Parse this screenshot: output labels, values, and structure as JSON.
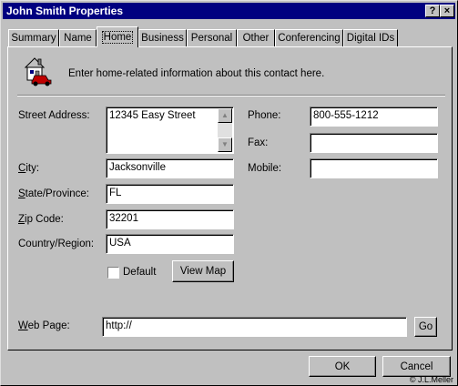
{
  "window": {
    "title": "John Smith Properties",
    "help_glyph": "?",
    "close_glyph": "×"
  },
  "tabs": [
    "Summary",
    "Name",
    "Home",
    "Business",
    "Personal",
    "Other",
    "Conferencing",
    "Digital IDs"
  ],
  "active_tab": "Home",
  "header": {
    "icon": "house-car-icon",
    "text": "Enter home-related information about this contact here."
  },
  "left_fields": {
    "street": {
      "label_u": "",
      "label_rest": "Street Address:",
      "value": "12345 Easy Street"
    },
    "city": {
      "label_u": "C",
      "label_rest": "ity:",
      "value": "Jacksonville"
    },
    "state": {
      "label_u": "S",
      "label_rest": "tate/Province:",
      "value": "FL"
    },
    "zip": {
      "label_u": "Z",
      "label_rest": "ip Code:",
      "value": "32201"
    },
    "country": {
      "label_u": "",
      "label_rest": "Country/Region:",
      "value": "USA"
    }
  },
  "right_fields": {
    "phone": {
      "label": "Phone:",
      "value": "800-555-1212"
    },
    "fax": {
      "label": "Fax:",
      "value": ""
    },
    "mobile": {
      "label": "Mobile:",
      "value": ""
    }
  },
  "default_checkbox": {
    "label": "Default",
    "checked": false
  },
  "view_map": "View Map",
  "web_page": {
    "label_u": "W",
    "label_rest": "eb Page:",
    "value": "http://",
    "go": "Go"
  },
  "buttons": {
    "ok": "OK",
    "cancel": "Cancel"
  },
  "copyright": "© J.L.Meller"
}
